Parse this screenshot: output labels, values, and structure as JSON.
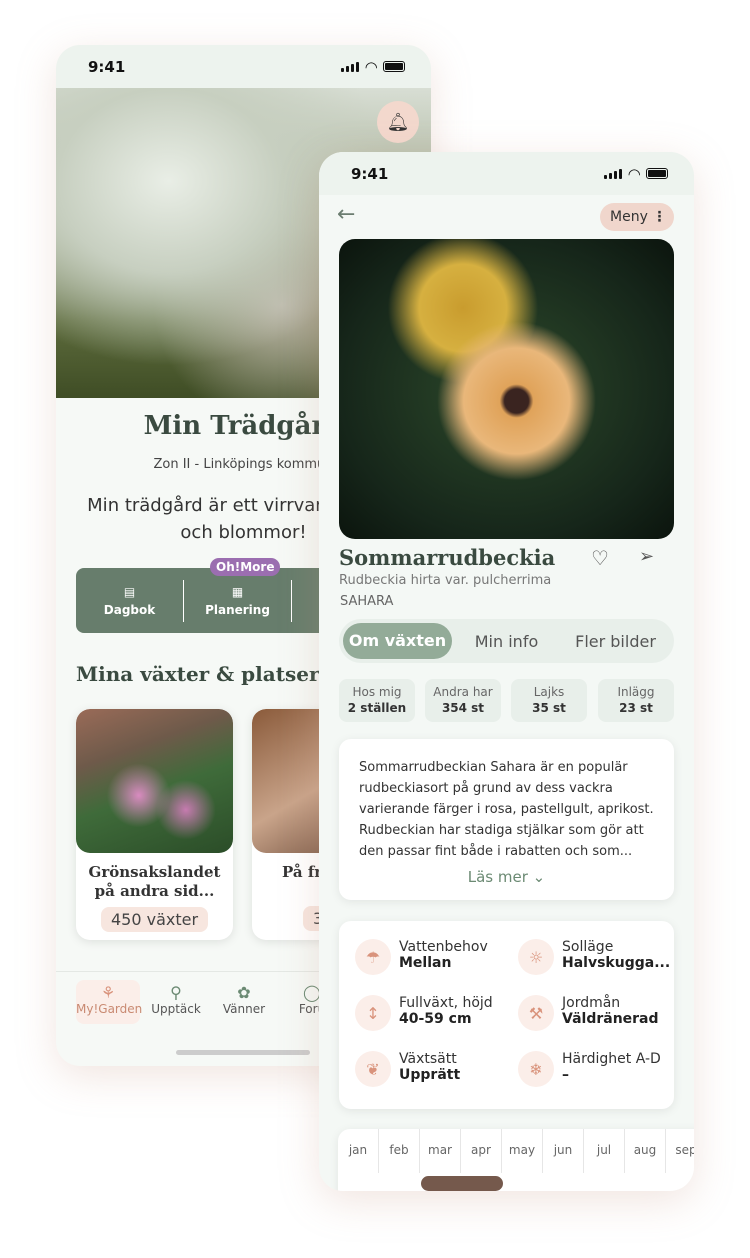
{
  "back": {
    "time": "9:41",
    "title": "Min Trädgård",
    "zone": "Zon II  -  Linköpings kommun",
    "description": "Min trädgård är ett virrvarr av träd och blommor!",
    "badge": "Oh!More",
    "actions": [
      {
        "label": "Dagbok",
        "icon": "notebook-icon"
      },
      {
        "label": "Planering",
        "icon": "calendar-icon"
      }
    ],
    "section_title": "Mina växter &  platser",
    "places": [
      {
        "name": "Grönsakslandet på andra sid...",
        "count": "450 växter"
      },
      {
        "name": "På fra",
        "count": "34 v"
      }
    ],
    "nav": [
      {
        "label": "My!Garden",
        "icon": "sprout-icon"
      },
      {
        "label": "Upptäck",
        "icon": "search-icon"
      },
      {
        "label": "Vänner",
        "icon": "flower-icon"
      },
      {
        "label": "Foru",
        "icon": "chat-icon"
      }
    ]
  },
  "front": {
    "time": "9:41",
    "menu": "Meny",
    "name": "Sommarrudbeckia",
    "latin": "Rudbeckia hirta var. pulcherrima",
    "cultivar": "SAHARA",
    "tabs": [
      "Om växten",
      "Min info",
      "Fler bilder"
    ],
    "stats": [
      {
        "label": "Hos mig",
        "value": "2 ställen"
      },
      {
        "label": "Andra har",
        "value": "354 st"
      },
      {
        "label": "Lajks",
        "value": "35 st"
      },
      {
        "label": "Inlägg",
        "value": "23 st"
      }
    ],
    "description": "Sommarrudbeckian Sahara är en populär rudbeckiasort på grund av dess vackra varierande färger i rosa, pastellgult, aprikost. Rudbeckian har stadiga stjälkar som gör att den passar fint både i rabatten och som...",
    "read_more": "Läs mer",
    "info": [
      {
        "label": "Vattenbehov",
        "value": "Mellan",
        "icon": "watering-can-icon"
      },
      {
        "label": "Solläge",
        "value": "Halvskugga...",
        "icon": "sun-icon"
      },
      {
        "label": "Fullväxt, höjd",
        "value": "40-59 cm",
        "icon": "height-icon"
      },
      {
        "label": "Jordmån",
        "value": "Väldränerad",
        "icon": "shovel-icon"
      },
      {
        "label": "Växtsätt",
        "value": "Upprätt",
        "icon": "leaf-icon"
      },
      {
        "label": "Härdighet A-D",
        "value": "–",
        "icon": "snowflake-icon"
      }
    ],
    "months": [
      "jan",
      "feb",
      "mar",
      "apr",
      "may",
      "jun",
      "jul",
      "aug",
      "sep"
    ],
    "bloom_months": [
      "mar",
      "apr"
    ],
    "colors": {
      "accent": "#677d6c",
      "bloom": "#75594c",
      "icon": "#d9937c"
    }
  }
}
